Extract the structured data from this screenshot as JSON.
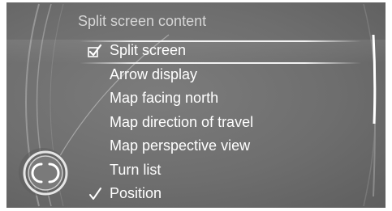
{
  "header": {
    "title": "Split screen content"
  },
  "menu": {
    "items": [
      {
        "label": "Split screen",
        "checked": true,
        "check_style": "checkbox",
        "selected": true
      },
      {
        "label": "Arrow display",
        "checked": false,
        "selected": false
      },
      {
        "label": "Map facing north",
        "checked": false,
        "selected": false
      },
      {
        "label": "Map direction of travel",
        "checked": false,
        "selected": false
      },
      {
        "label": "Map perspective view",
        "checked": false,
        "selected": false
      },
      {
        "label": "Turn list",
        "checked": false,
        "selected": false
      },
      {
        "label": "Position",
        "checked": true,
        "check_style": "radio-check",
        "selected": false
      }
    ]
  },
  "icons": {
    "controller": "controller-knob-icon",
    "checkbox_checked": "checkbox-checked-icon",
    "check_mark": "check-mark-icon"
  },
  "colors": {
    "background": "#6e6e6e",
    "text": "#ffffff",
    "title_text": "#d6d6d6",
    "highlight": "#f2f2f2"
  }
}
